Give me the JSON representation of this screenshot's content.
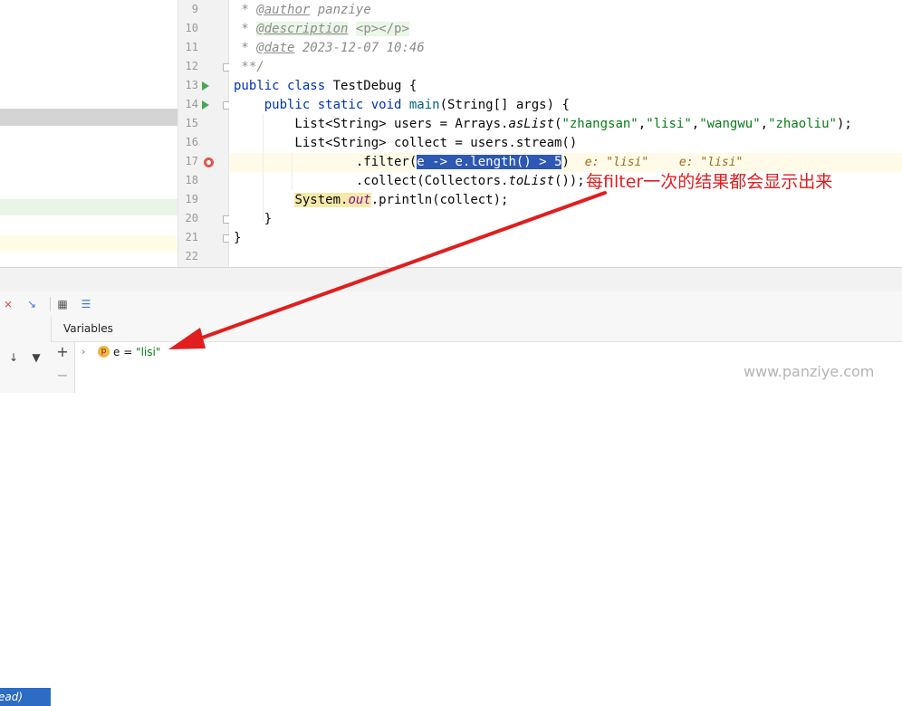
{
  "editor": {
    "line_numbers": [
      "9",
      "10",
      "11",
      "12",
      "13",
      "14",
      "15",
      "16",
      "17",
      "18",
      "19",
      "20",
      "21",
      "22"
    ],
    "inline_hints": [
      "e: \"lisi\"",
      "e: \"lisi\""
    ],
    "selected_expr": "e -> e.length() > 5"
  },
  "annotation": {
    "text": "每filter一次的结果都会显示出来",
    "color": "#e11d1d"
  },
  "variables_panel": {
    "title": "Variables",
    "frame_label": "ead)",
    "var": {
      "badge": "p",
      "name": "e",
      "eq": " = ",
      "value": "\"lisi\""
    }
  },
  "colors": {
    "keyword": "#0033b3",
    "string": "#067d17",
    "comment": "#8c8c8c",
    "selection": "#2d58b3",
    "run_icon": "#4aa552",
    "breakpoint": "#e2564d"
  },
  "icons": [
    "run-icon",
    "breakpoint-icon",
    "fold-icon",
    "chevron-right-icon",
    "filter-icon",
    "add-icon",
    "remove-icon",
    "down-arrow-icon",
    "table-icon"
  ],
  "watermark": "www.panziye.com"
}
